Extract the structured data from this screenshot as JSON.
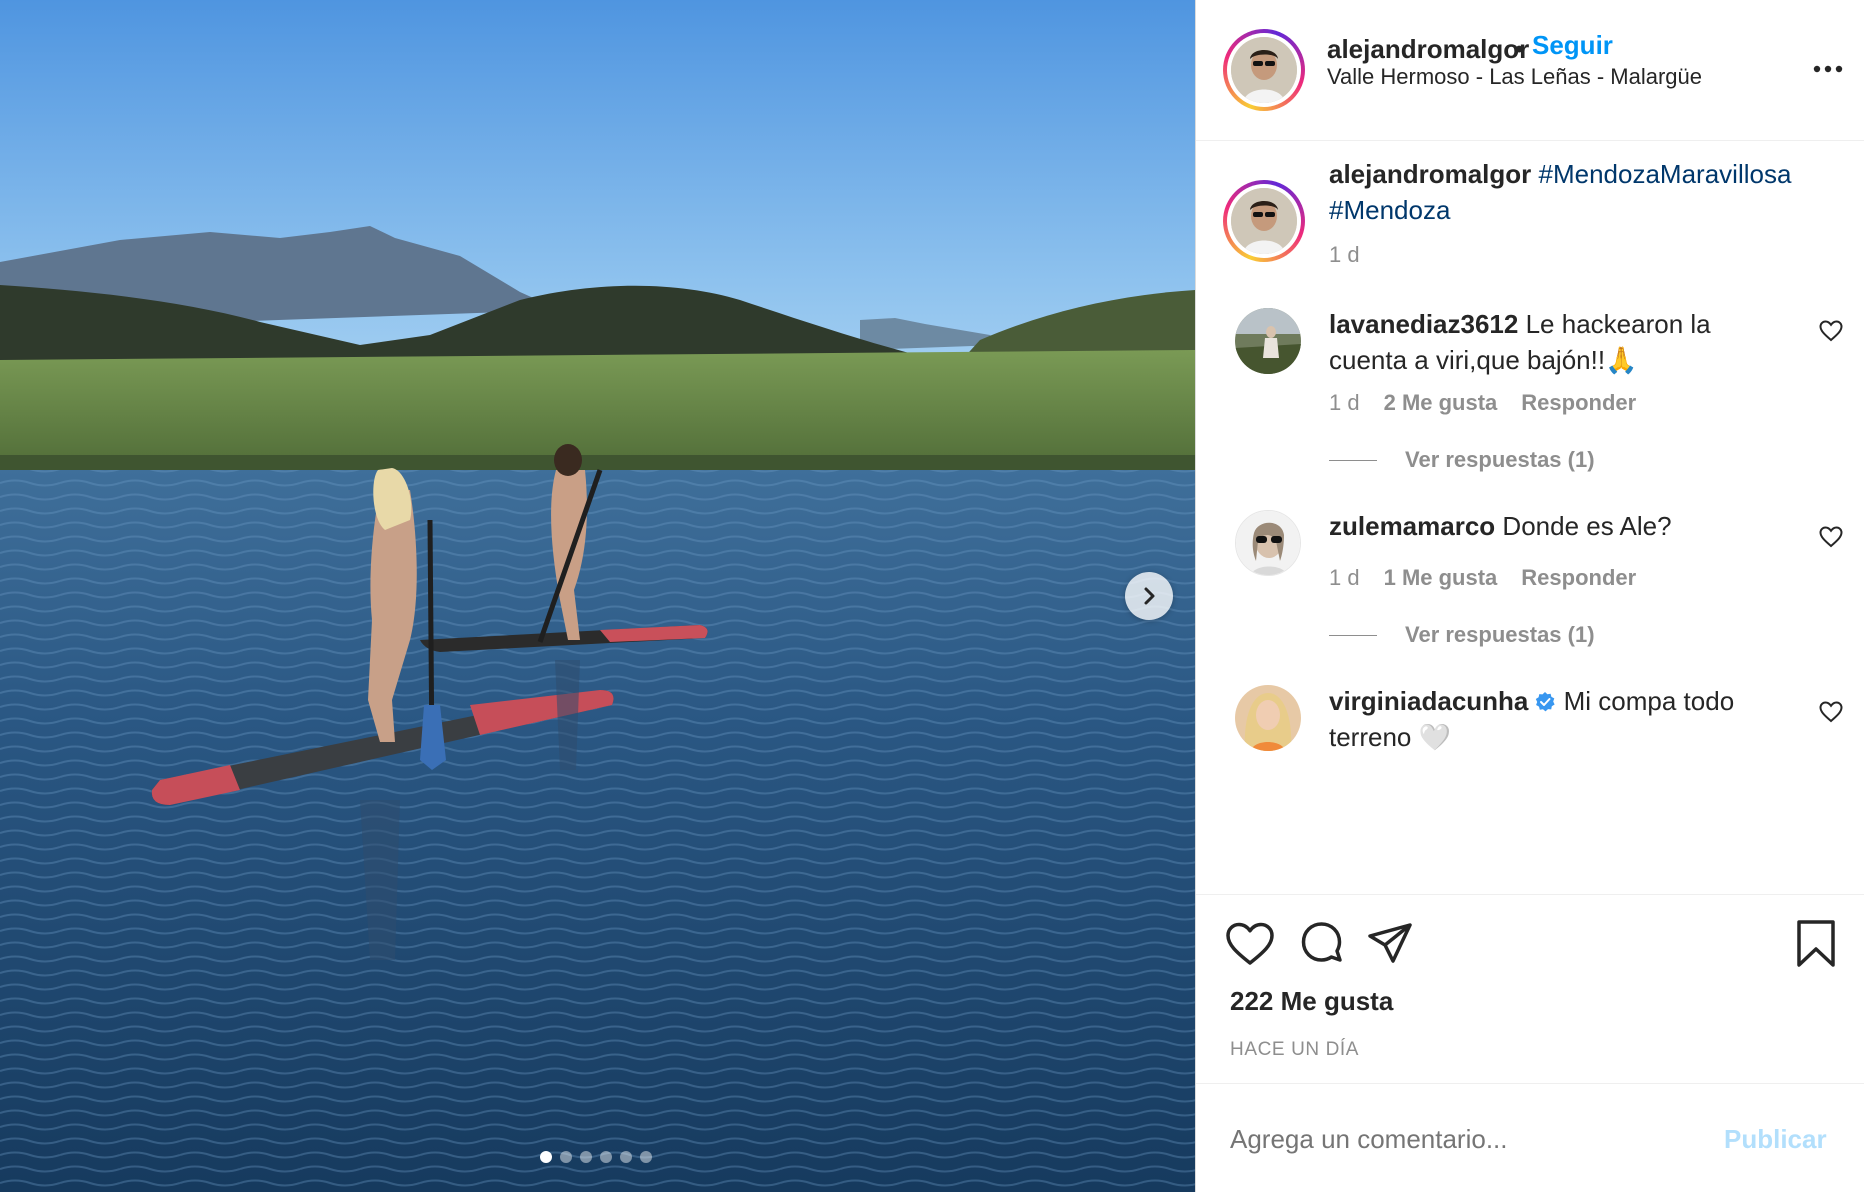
{
  "colors": {
    "link_blue": "#0095f6",
    "hashtag": "#00376b",
    "muted": "#8e8e8e",
    "text": "#262626",
    "publish_disabled": "#b2dffc"
  },
  "carousel": {
    "total_images": 6,
    "active_index": 0,
    "next_icon": "chevron-right-icon"
  },
  "header": {
    "username": "alejandromalgor",
    "separator": "•",
    "follow_label": "Seguir",
    "location": "Valle Hermoso - Las Leñas - Malargüe",
    "more_icon": "more-options-icon"
  },
  "caption": {
    "username": "alejandromalgor",
    "hashtag_1": "#MendozaMaravillosa",
    "hashtag_2": "#Mendoza",
    "time": "1 d"
  },
  "comments": [
    {
      "username": "lavanediaz3612",
      "text": "Le hackearon la cuenta a viri,que bajón!!🙏",
      "time": "1 d",
      "likes": "2 Me gusta",
      "reply_label": "Responder",
      "view_replies": "Ver respuestas (1)"
    },
    {
      "username": "zulemamarco",
      "text": "Donde es Ale?",
      "time": "1 d",
      "likes": "1 Me gusta",
      "reply_label": "Responder",
      "view_replies": "Ver respuestas (1)"
    },
    {
      "username": "virginiadacunha",
      "verified": true,
      "text": "Mi compa todo terreno 🤍"
    }
  ],
  "actions": {
    "like_icon": "heart-icon",
    "comment_icon": "comment-icon",
    "share_icon": "share-icon",
    "save_icon": "bookmark-icon",
    "likes_count": "222 Me gusta",
    "time_ago": "HACE UN DÍA"
  },
  "comment_input": {
    "placeholder": "Agrega un comentario...",
    "publish_label": "Publicar"
  }
}
